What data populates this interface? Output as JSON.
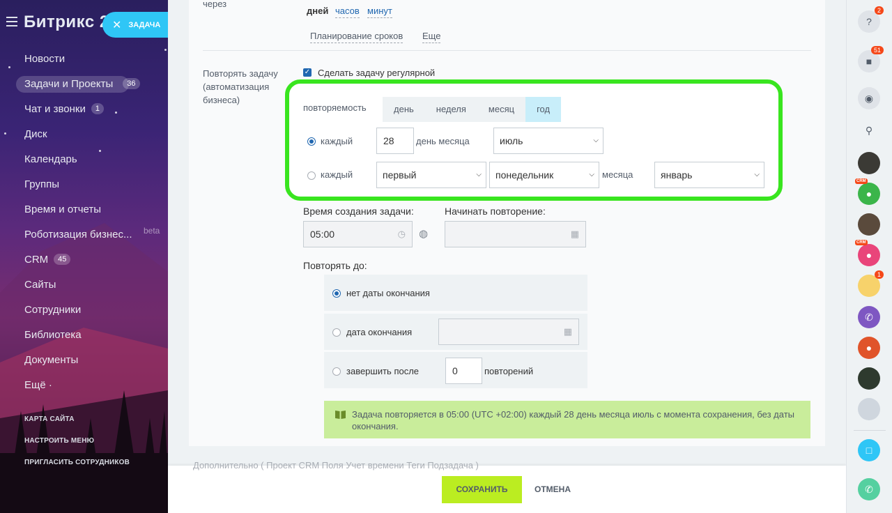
{
  "sidebar": {
    "logo": "Битрикс 24",
    "task_pill": "ЗАДАЧА",
    "items": [
      {
        "label": "Новости"
      },
      {
        "label": "Задачи и Проекты",
        "badge": "36"
      },
      {
        "label": "Чат и звонки",
        "badge": "1"
      },
      {
        "label": "Диск"
      },
      {
        "label": "Календарь"
      },
      {
        "label": "Группы"
      },
      {
        "label": "Время и отчеты"
      },
      {
        "label": "Роботизация бизнес...",
        "tag": "beta"
      },
      {
        "label": "CRM",
        "badge": "45"
      },
      {
        "label": "Сайты"
      },
      {
        "label": "Сотрудники"
      },
      {
        "label": "Библиотека"
      },
      {
        "label": "Документы"
      },
      {
        "label": "Ещё ·"
      }
    ],
    "bottom_links": [
      "КАРТА САЙТА",
      "НАСТРОИТЬ МЕНЮ",
      "ПРИГЛАСИТЬ СОТРУДНИКОВ"
    ]
  },
  "form": {
    "top_label": "через",
    "units": {
      "days": "дней",
      "hours": "часов",
      "minutes": "минут"
    },
    "links": {
      "planning": "Планирование сроков",
      "more": "Еще"
    },
    "repeat_label": "Повторять задачу (автоматизация бизнеса)",
    "repeat_checkbox": "Сделать задачу регулярной",
    "repeat": {
      "periodicity_label": "повторяемость",
      "tabs": [
        {
          "label": "день",
          "selected": false
        },
        {
          "label": "неделя",
          "selected": false
        },
        {
          "label": "месяц",
          "selected": false
        },
        {
          "label": "год",
          "selected": true
        }
      ],
      "row1": {
        "label": "каждый",
        "day": "28",
        "suffix": "день месяца",
        "month": "июль"
      },
      "row2": {
        "label": "каждый",
        "ordinal": "первый",
        "weekday": "понедельник",
        "middle": "месяца",
        "month": "январь"
      }
    },
    "creation_time_label": "Время создания задачи:",
    "creation_time": "05:00",
    "start_label": "Начинать повторение:",
    "repeat_until_label": "Повторять до:",
    "until_options": [
      {
        "label": "нет даты окончания",
        "selected": true
      },
      {
        "label": "дата окончания",
        "selected": false
      },
      {
        "label": "завершить после",
        "selected": false,
        "count": "0",
        "suffix": "повторений"
      }
    ],
    "summary": "Задача повторяется в 05:00 (UTC +02:00) каждый 28 день месяца июль с момента сохранения, без даты окончания.",
    "additional_faded": "Дополнительно  ( Проект   CRM   Поля   Учет времени   Теги   Подзадача )"
  },
  "footer": {
    "save": "СОХРАНИТЬ",
    "cancel": "ОТМЕНА"
  },
  "right_sidebar": {
    "help_badge": "2",
    "notif_badge": "51",
    "avatar_badge": "1",
    "crm_tag": "CRM"
  },
  "colors": {
    "accent_blue": "#2fc6f6",
    "highlight_green": "#39e51f",
    "save_green": "#bbed21",
    "info_green": "#c9ed9b"
  }
}
